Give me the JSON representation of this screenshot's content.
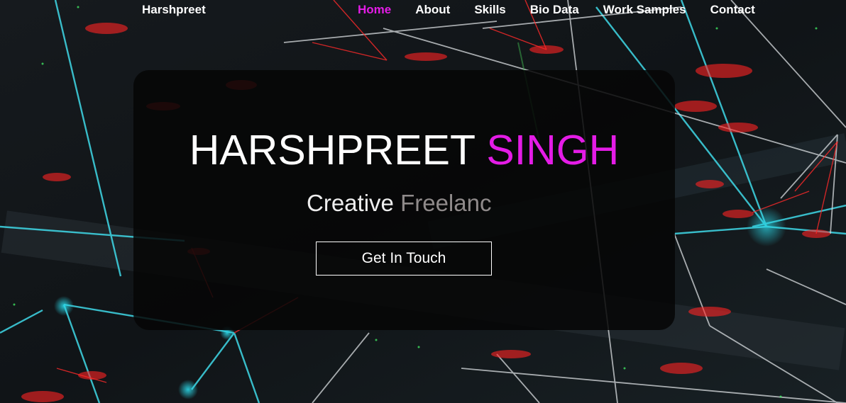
{
  "nav": {
    "brand": "Harshpreet",
    "links": [
      {
        "label": "Home",
        "active": true
      },
      {
        "label": "About"
      },
      {
        "label": "Skills"
      },
      {
        "label": "Bio Data"
      },
      {
        "label": "Work Samples"
      },
      {
        "label": "Contact"
      }
    ]
  },
  "hero": {
    "first_name": "HARSHPREET",
    "last_name": "SINGH",
    "subtitle_static": "Creative",
    "subtitle_typed": "Freelanc",
    "cta_label": "Get In Touch"
  },
  "colors": {
    "accent": "#e41ce6",
    "card_bg": "rgba(6,6,6,0.86)",
    "typed_text": "#8f8a8a"
  }
}
